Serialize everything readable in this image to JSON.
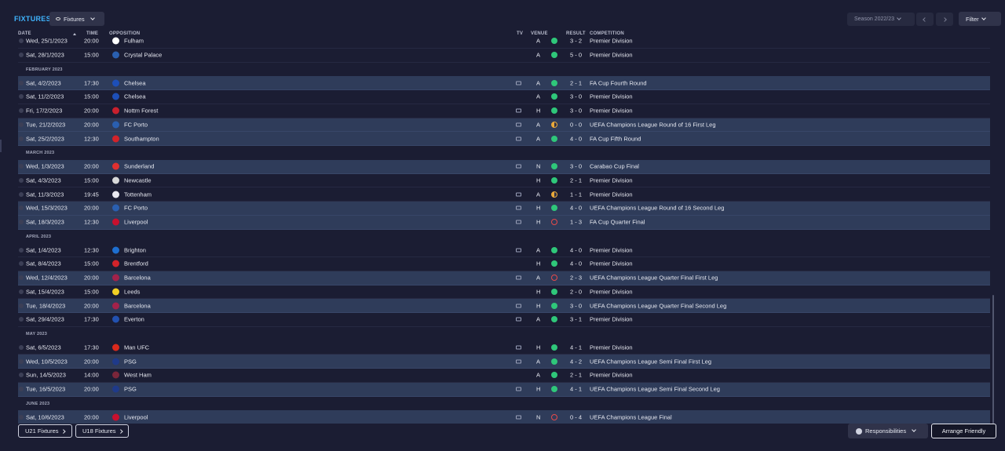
{
  "header": {
    "title": "FIXTURES",
    "view_dropdown": "Fixtures",
    "season": "Season 2022/23",
    "filter_label": "Filter"
  },
  "columns": {
    "date": "DATE",
    "time": "TIME",
    "opposition": "OPPOSITION",
    "tv": "TV",
    "venue": "VENUE",
    "result": "RESULT",
    "competition": "COMPETITION"
  },
  "colors": {
    "win": "#2fc77a",
    "draw": "#e9a93a",
    "loss": "#e64a4a",
    "accent": "#3fb5ff"
  },
  "rows": [
    {
      "kind": "fixture",
      "date": "Wed, 25/1/2023",
      "time": "20:00",
      "opp": "Fulham",
      "crest": "#ffffff",
      "tv": false,
      "venue": "A",
      "res": "W",
      "score": "3 - 2",
      "comp": "Premier Division",
      "alt": false
    },
    {
      "kind": "fixture",
      "date": "Sat, 28/1/2023",
      "time": "15:00",
      "opp": "Crystal Palace",
      "crest": "#2a5fb0",
      "tv": false,
      "venue": "A",
      "res": "W",
      "score": "5 - 0",
      "comp": "Premier Division",
      "alt": false
    },
    {
      "kind": "section",
      "label": "FEBRUARY 2023"
    },
    {
      "kind": "fixture",
      "date": "Sat, 4/2/2023",
      "time": "17:30",
      "opp": "Chelsea",
      "crest": "#1d4fb8",
      "tv": true,
      "venue": "A",
      "res": "W",
      "score": "2 - 1",
      "comp": "FA Cup Fourth Round",
      "alt": true
    },
    {
      "kind": "fixture",
      "date": "Sat, 11/2/2023",
      "time": "15:00",
      "opp": "Chelsea",
      "crest": "#1d4fb8",
      "tv": false,
      "venue": "A",
      "res": "W",
      "score": "3 - 0",
      "comp": "Premier Division",
      "alt": false
    },
    {
      "kind": "fixture",
      "date": "Fri, 17/2/2023",
      "time": "20:00",
      "opp": "Nottm Forest",
      "crest": "#c8202d",
      "tv": true,
      "venue": "H",
      "res": "W",
      "score": "3 - 0",
      "comp": "Premier Division",
      "alt": false
    },
    {
      "kind": "fixture",
      "date": "Tue, 21/2/2023",
      "time": "20:00",
      "opp": "FC Porto",
      "crest": "#2a5fb0",
      "tv": true,
      "venue": "A",
      "res": "D",
      "score": "0 - 0",
      "comp": "UEFA Champions League Round of 16  First Leg",
      "alt": true
    },
    {
      "kind": "fixture",
      "date": "Sat, 25/2/2023",
      "time": "12:30",
      "opp": "Southampton",
      "crest": "#d2232a",
      "tv": true,
      "venue": "A",
      "res": "W",
      "score": "4 - 0",
      "comp": "FA Cup Fifth Round",
      "alt": true
    },
    {
      "kind": "section",
      "label": "MARCH 2023"
    },
    {
      "kind": "fixture",
      "date": "Wed, 1/3/2023",
      "time": "20:00",
      "opp": "Sunderland",
      "crest": "#e03030",
      "tv": true,
      "venue": "N",
      "res": "W",
      "score": "3 - 0",
      "comp": "Carabao Cup Final",
      "alt": true
    },
    {
      "kind": "fixture",
      "date": "Sat, 4/3/2023",
      "time": "15:00",
      "opp": "Newcastle",
      "crest": "#d8d8d8",
      "tv": false,
      "venue": "H",
      "res": "W",
      "score": "2 - 1",
      "comp": "Premier Division",
      "alt": false
    },
    {
      "kind": "fixture",
      "date": "Sat, 11/3/2023",
      "time": "19:45",
      "opp": "Tottenham",
      "crest": "#e8e8f0",
      "tv": true,
      "venue": "A",
      "res": "D",
      "score": "1 - 1",
      "comp": "Premier Division",
      "alt": false
    },
    {
      "kind": "fixture",
      "date": "Wed, 15/3/2023",
      "time": "20:00",
      "opp": "FC Porto",
      "crest": "#2a5fb0",
      "tv": true,
      "venue": "H",
      "res": "W",
      "score": "4 - 0",
      "comp": "UEFA Champions League Round of 16  Second Leg",
      "alt": true
    },
    {
      "kind": "fixture",
      "date": "Sat, 18/3/2023",
      "time": "12:30",
      "opp": "Liverpool",
      "crest": "#c8102e",
      "tv": true,
      "venue": "H",
      "res": "L",
      "score": "1 - 3",
      "comp": "FA Cup Quarter Final",
      "alt": true
    },
    {
      "kind": "section",
      "label": "APRIL 2023"
    },
    {
      "kind": "fixture",
      "date": "Sat, 1/4/2023",
      "time": "12:30",
      "opp": "Brighton",
      "crest": "#1e6fd0",
      "tv": true,
      "venue": "A",
      "res": "W",
      "score": "4 - 0",
      "comp": "Premier Division",
      "alt": false
    },
    {
      "kind": "fixture",
      "date": "Sat, 8/4/2023",
      "time": "15:00",
      "opp": "Brentford",
      "crest": "#d2232a",
      "tv": false,
      "venue": "H",
      "res": "W",
      "score": "4 - 0",
      "comp": "Premier Division",
      "alt": false
    },
    {
      "kind": "fixture",
      "date": "Wed, 12/4/2023",
      "time": "20:00",
      "opp": "Barcelona",
      "crest": "#a3224a",
      "tv": true,
      "venue": "A",
      "res": "L",
      "score": "2 - 3",
      "comp": "UEFA Champions League Quarter Final First Leg",
      "alt": true
    },
    {
      "kind": "fixture",
      "date": "Sat, 15/4/2023",
      "time": "15:00",
      "opp": "Leeds",
      "crest": "#f2d024",
      "tv": false,
      "venue": "H",
      "res": "W",
      "score": "2 - 0",
      "comp": "Premier Division",
      "alt": false
    },
    {
      "kind": "fixture",
      "date": "Tue, 18/4/2023",
      "time": "20:00",
      "opp": "Barcelona",
      "crest": "#a3224a",
      "tv": true,
      "venue": "H",
      "res": "W",
      "score": "3 - 0",
      "comp": "UEFA Champions League Quarter Final Second Leg",
      "alt": true
    },
    {
      "kind": "fixture",
      "date": "Sat, 29/4/2023",
      "time": "17:30",
      "opp": "Everton",
      "crest": "#2251b0",
      "tv": true,
      "venue": "A",
      "res": "W",
      "score": "3 - 1",
      "comp": "Premier Division",
      "alt": false
    },
    {
      "kind": "section",
      "label": "MAY 2023"
    },
    {
      "kind": "fixture",
      "date": "Sat, 6/5/2023",
      "time": "17:30",
      "opp": "Man UFC",
      "crest": "#da291c",
      "tv": true,
      "venue": "H",
      "res": "W",
      "score": "4 - 1",
      "comp": "Premier Division",
      "alt": false
    },
    {
      "kind": "fixture",
      "date": "Wed, 10/5/2023",
      "time": "20:00",
      "opp": "PSG",
      "crest": "#1f3a8a",
      "tv": true,
      "venue": "A",
      "res": "W",
      "score": "4 - 2",
      "comp": "UEFA Champions League Semi Final First Leg",
      "alt": true
    },
    {
      "kind": "fixture",
      "date": "Sun, 14/5/2023",
      "time": "14:00",
      "opp": "West Ham",
      "crest": "#7a263a",
      "tv": false,
      "venue": "A",
      "res": "W",
      "score": "2 - 1",
      "comp": "Premier Division",
      "alt": false
    },
    {
      "kind": "fixture",
      "date": "Tue, 16/5/2023",
      "time": "20:00",
      "opp": "PSG",
      "crest": "#1f3a8a",
      "tv": true,
      "venue": "H",
      "res": "W",
      "score": "4 - 1",
      "comp": "UEFA Champions League Semi Final Second Leg",
      "alt": true
    },
    {
      "kind": "section",
      "label": "JUNE 2023"
    },
    {
      "kind": "fixture",
      "date": "Sat, 10/6/2023",
      "time": "20:00",
      "opp": "Liverpool",
      "crest": "#c8102e",
      "tv": true,
      "venue": "N",
      "res": "L",
      "score": "0 - 4",
      "comp": "UEFA Champions League Final",
      "alt": true
    }
  ],
  "footer": {
    "u21": "U21 Fixtures",
    "u18": "U18 Fixtures",
    "responsibilities": "Responsibilities",
    "arrange": "Arrange Friendly"
  }
}
